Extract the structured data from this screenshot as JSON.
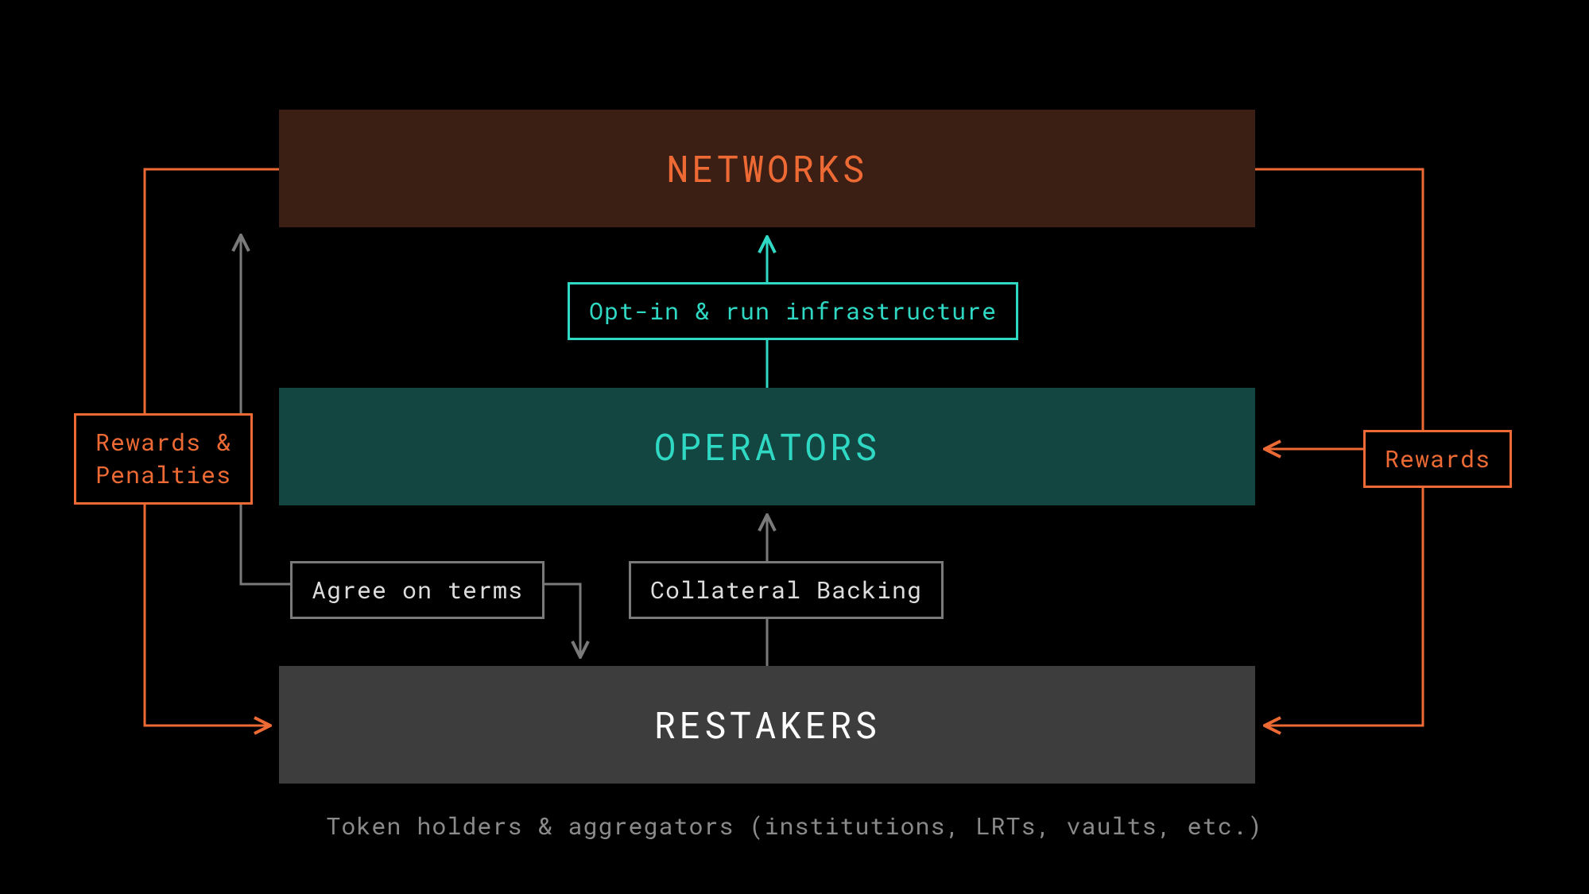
{
  "blocks": {
    "networks": "NETWORKS",
    "operators": "OPERATORS",
    "restakers": "RESTAKERS"
  },
  "labels": {
    "optin": "Opt-in & run infrastructure",
    "agree": "Agree on terms",
    "collateral": "Collateral Backing",
    "rewards_penalties_line1": "Rewards &",
    "rewards_penalties_line2": "Penalties",
    "rewards": "Rewards"
  },
  "subtitle": "Token holders & aggregators (institutions, LRTs, vaults, etc.)",
  "colors": {
    "orange": "#ed6a34",
    "cyan": "#2fd8c3",
    "gray": "#7a7a7a",
    "dark_orange": "#3c1f14",
    "dark_teal": "#134641",
    "dark_gray": "#3d3d3d"
  }
}
